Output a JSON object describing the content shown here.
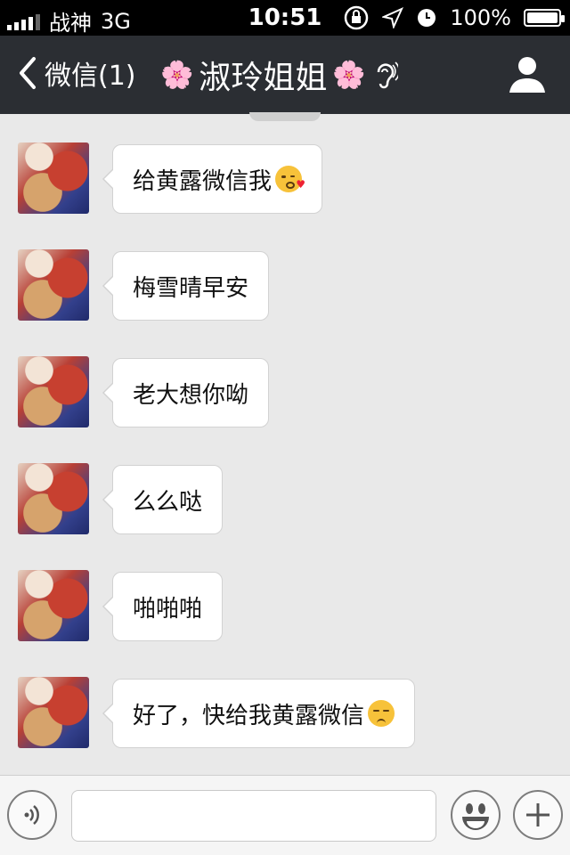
{
  "status_bar": {
    "carrier": "战神",
    "network": "3G",
    "time": "10:51",
    "battery": "100%",
    "battery_level": 1.0
  },
  "nav": {
    "back_label": "微信(1)",
    "title": "淑玲姐姐",
    "title_decoration": "🌸"
  },
  "messages": [
    {
      "text": "给黄露微信我",
      "emoji": "kissing-face-icon"
    },
    {
      "text": "梅雪晴早安",
      "emoji": ""
    },
    {
      "text": "老大想你呦",
      "emoji": ""
    },
    {
      "text": "么么哒",
      "emoji": ""
    },
    {
      "text": "啪啪啪",
      "emoji": ""
    },
    {
      "text": "好了，快给我黄露微信",
      "emoji": "unamused-face-icon"
    }
  ],
  "input": {
    "value": "",
    "placeholder": ""
  },
  "colors": {
    "nav_background": "#2b2e33",
    "chat_background": "#e9e9e9",
    "bubble": "#ffffff"
  }
}
